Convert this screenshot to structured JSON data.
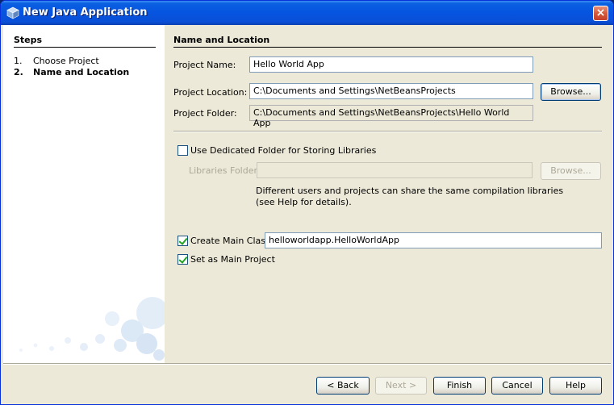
{
  "window": {
    "title": "New Java Application",
    "close_icon": "×"
  },
  "steps": {
    "header": "Steps",
    "items": [
      {
        "num": "1.",
        "label": "Choose Project"
      },
      {
        "num": "2.",
        "label": "Name and Location"
      }
    ]
  },
  "section": {
    "header": "Name and Location"
  },
  "project_name": {
    "label": "Project Name:",
    "value": "Hello World App"
  },
  "project_location": {
    "label": "Project Location:",
    "value": "C:\\Documents and Settings\\NetBeansProjects",
    "browse": "Browse..."
  },
  "project_folder": {
    "label": "Project Folder:",
    "value": "C:\\Documents and Settings\\NetBeansProjects\\Hello World App"
  },
  "libraries": {
    "checkbox_label": "Use Dedicated Folder for Storing Libraries",
    "checked": false,
    "folder_label": "Libraries Folder:",
    "folder_value": "",
    "browse": "Browse...",
    "hint_line1": "Different users and projects can share the same compilation libraries",
    "hint_line2": "(see Help for details)."
  },
  "main_class": {
    "label": "Create Main Class",
    "checked": true,
    "value": "helloworldapp.HelloWorldApp"
  },
  "main_project": {
    "label": "Set as Main Project",
    "checked": true
  },
  "buttons": {
    "back": "< Back",
    "next": "Next >",
    "finish": "Finish",
    "cancel": "Cancel",
    "help": "Help"
  },
  "colors": {
    "titlebar": "#0654e0",
    "dialog_bg": "#ece9d8",
    "accent_border": "#003c74"
  }
}
